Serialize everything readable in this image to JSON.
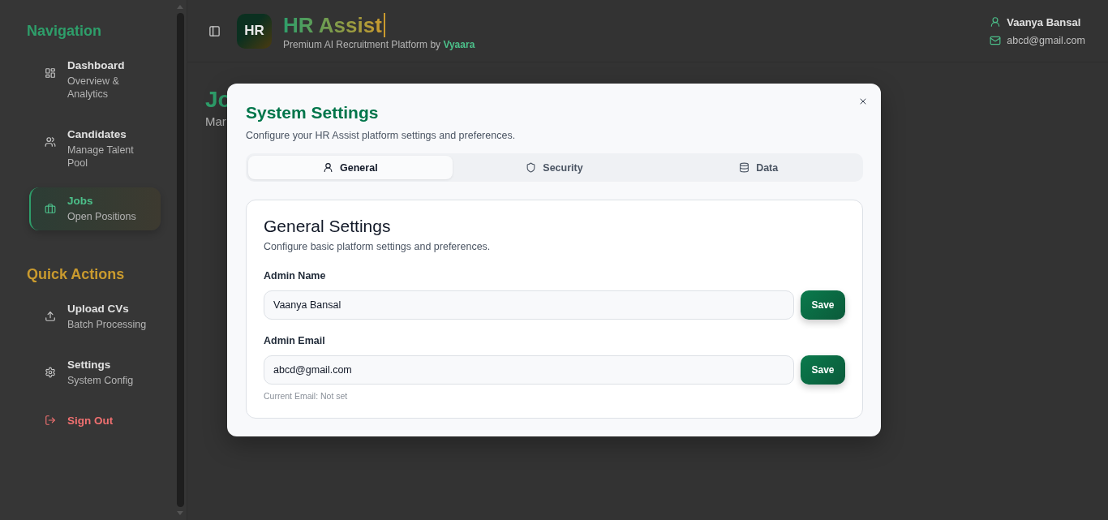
{
  "sidebar": {
    "sections": [
      {
        "title": "Navigation",
        "color": "#2e9e6a",
        "items": [
          {
            "label": "Dashboard",
            "description": "Overview & Analytics",
            "selected": false
          },
          {
            "label": "Candidates",
            "description": "Manage Talent Pool",
            "selected": false
          },
          {
            "label": "Jobs",
            "description": "Open Positions",
            "selected": true
          }
        ]
      },
      {
        "title": "Quick Actions",
        "color": "#c99a2e",
        "items": [
          {
            "label": "Upload CVs",
            "description": "Batch Processing",
            "kind": "action"
          },
          {
            "label": "Settings",
            "description": "System Config",
            "kind": "action"
          },
          {
            "label": "Sign Out",
            "kind": "danger"
          }
        ]
      }
    ]
  },
  "header": {
    "logo": "HR",
    "title": "HR Assist",
    "tagline": "Premium AI Recruitment Platform by ",
    "tagline_brand": "Vyaara",
    "user_name": "Vaanya Bansal",
    "user_email": "abcd@gmail.com"
  },
  "page": {
    "title": "Jo",
    "subtitle": "Mar"
  },
  "dialog": {
    "title": "System Settings",
    "subtitle": "Configure your HR Assist platform settings and preferences.",
    "tabs": [
      {
        "label": "General",
        "selected": true
      },
      {
        "label": "Security",
        "selected": false
      },
      {
        "label": "Data",
        "selected": false
      }
    ],
    "card": {
      "title": "General Settings",
      "description": "Configure basic platform settings and preferences.",
      "fields": [
        {
          "label": "Admin Name",
          "value": "Vaanya Bansal",
          "button": "Save"
        },
        {
          "label": "Admin Email",
          "value": "abcd@gmail.com",
          "button": "Save",
          "hint": "Current Email: Not set"
        }
      ]
    }
  }
}
